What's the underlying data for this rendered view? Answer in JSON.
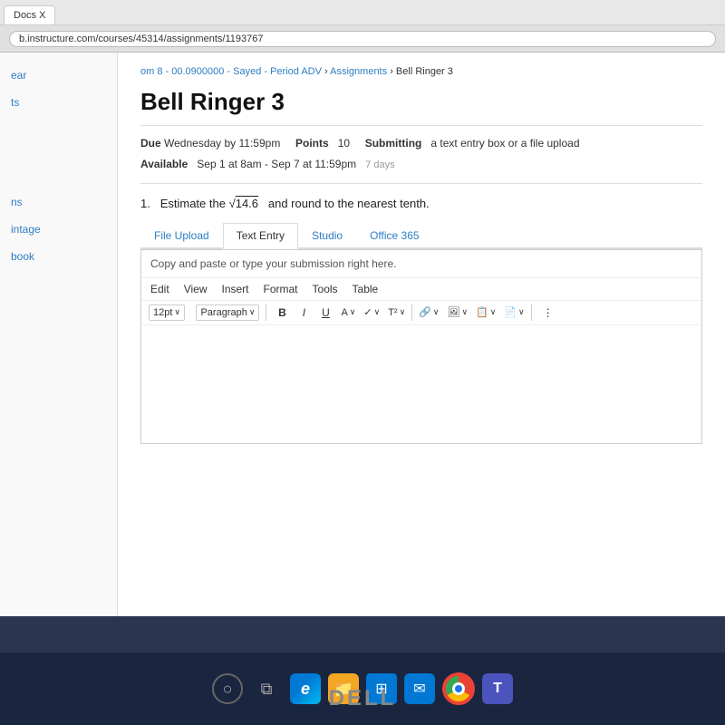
{
  "browser": {
    "address": "b.instructure.com/courses/45314/assignments/1193767",
    "tab_label": "Docs X"
  },
  "breadcrumb": {
    "parts": [
      {
        "text": "om 8 - 00.0900000 - Sayed - Period ADV",
        "type": "link"
      },
      {
        "text": " > ",
        "type": "separator"
      },
      {
        "text": "Assignments",
        "type": "link"
      },
      {
        "text": " > ",
        "type": "separator"
      },
      {
        "text": "Bell Ringer 3",
        "type": "text"
      }
    ],
    "full_text": "om 8 - 00.0900000 - Sayed - Period ADV > Assignments > Bell Ringer 3"
  },
  "page": {
    "title": "Bell Ringer 3",
    "due_label": "Due",
    "due_value": "Wednesday by 11:59pm",
    "points_label": "Points",
    "points_value": "10",
    "submitting_label": "Submitting",
    "submitting_value": "a text entry box or a file upload",
    "available_label": "Available",
    "available_value": "Sep 1 at 8am - Sep 7 at 11:59pm",
    "available_days": "7 days"
  },
  "question": {
    "number": "1.",
    "text": "Estimate the",
    "sqrt_content": "14.6",
    "text2": "and round to the nearest tenth."
  },
  "tabs": [
    {
      "id": "file-upload",
      "label": "File Upload",
      "active": false
    },
    {
      "id": "text-entry",
      "label": "Text Entry",
      "active": true
    },
    {
      "id": "studio",
      "label": "Studio",
      "active": false
    },
    {
      "id": "office-365",
      "label": "Office 365",
      "active": false
    }
  ],
  "editor": {
    "hint": "Copy and paste or type your submission right here.",
    "menu_items": [
      "Edit",
      "View",
      "Insert",
      "Format",
      "Tools",
      "Table"
    ],
    "font_size": "12pt",
    "paragraph": "Paragraph",
    "toolbar_buttons": [
      "B",
      "I",
      "U",
      "A",
      "✏",
      "T²",
      "🔗",
      "🖼",
      "📋",
      "📄"
    ],
    "more_icon": "⋮"
  },
  "sidebar": {
    "items": [
      {
        "label": "ear"
      },
      {
        "label": "ts"
      },
      {
        "label": "ns"
      },
      {
        "label": "intage"
      },
      {
        "label": "book"
      }
    ]
  },
  "taskbar": {
    "icons": [
      {
        "id": "search",
        "symbol": "○",
        "label": "Search"
      },
      {
        "id": "task-view",
        "symbol": "⧉",
        "label": "Task View"
      },
      {
        "id": "edge",
        "symbol": "e",
        "label": "Microsoft Edge"
      },
      {
        "id": "files",
        "symbol": "📁",
        "label": "File Explorer"
      },
      {
        "id": "start",
        "symbol": "⊞",
        "label": "Start"
      },
      {
        "id": "mail",
        "symbol": "✉",
        "label": "Mail"
      },
      {
        "id": "chrome",
        "symbol": "●",
        "label": "Chrome"
      },
      {
        "id": "teams",
        "symbol": "T",
        "label": "Microsoft Teams"
      }
    ],
    "dell_label": "DELL"
  }
}
